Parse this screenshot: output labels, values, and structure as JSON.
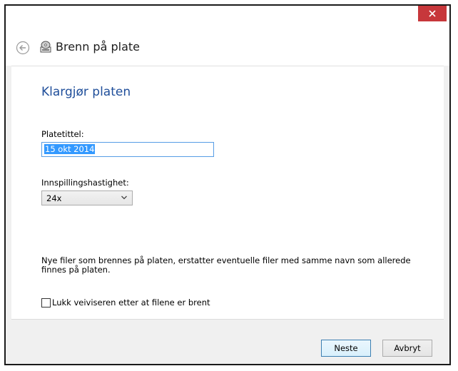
{
  "header": {
    "title": "Brenn på plate"
  },
  "page": {
    "title": "Klargjør platen",
    "disc_title_label": "Platetittel:",
    "disc_title_value": "15 okt 2014",
    "speed_label": "Innspillingshastighet:",
    "speed_value": "24x",
    "info_text": "Nye filer som brennes på platen, erstatter eventuelle filer med samme navn som allerede finnes på platen.",
    "close_wizard_label": "Lukk veiviseren etter at filene er brent",
    "close_wizard_checked": false
  },
  "footer": {
    "next_label": "Neste",
    "cancel_label": "Avbryt"
  },
  "colors": {
    "close_button": "#c7373b",
    "page_title": "#1f4e9a",
    "selection": "#3399ff",
    "input_focus_border": "#569de5"
  },
  "icons": {
    "close": "close-icon",
    "back": "back-arrow-icon",
    "app": "disc-burner-icon",
    "dropdown": "chevron-down-icon"
  }
}
